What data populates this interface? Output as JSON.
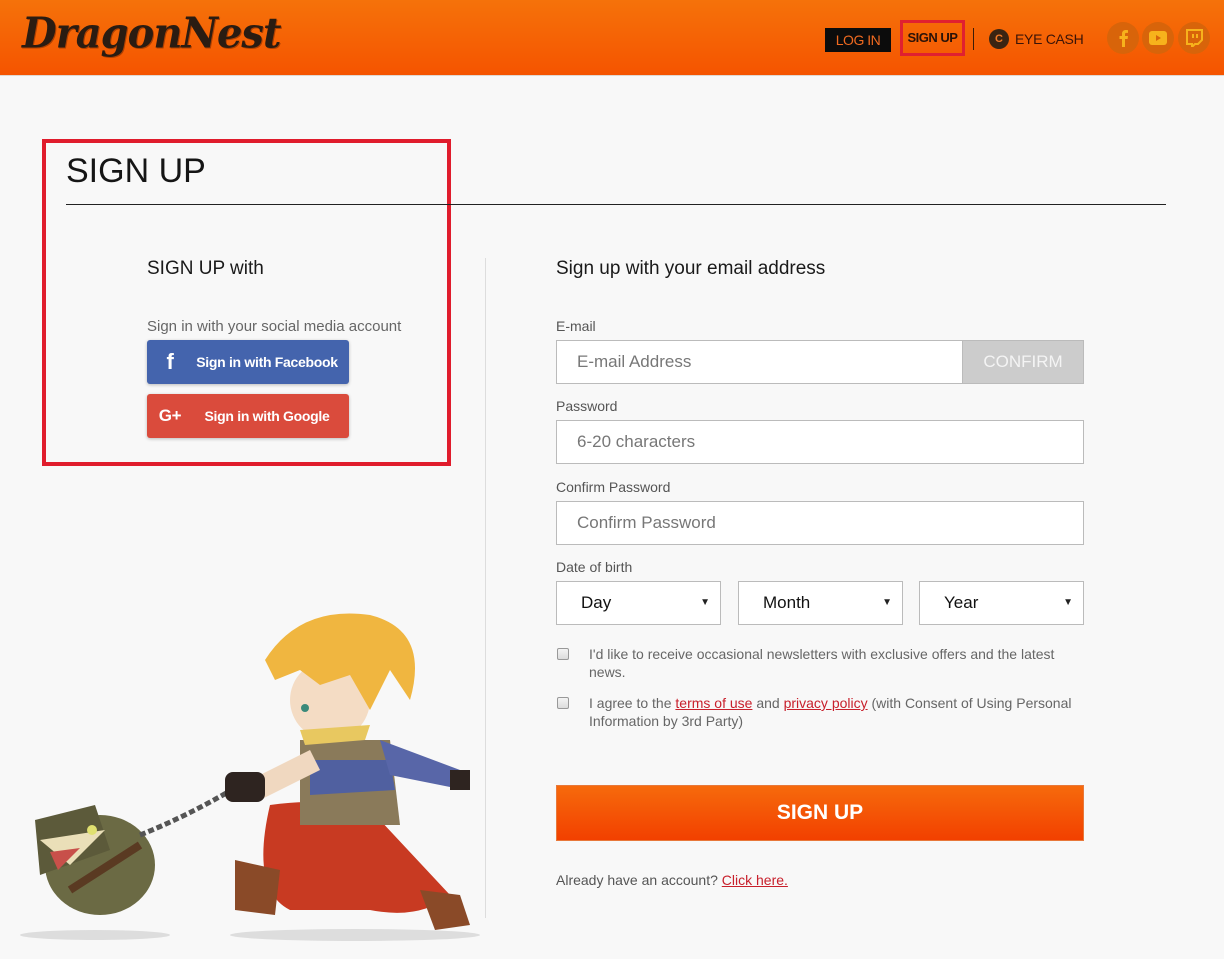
{
  "header": {
    "logo": "DragonNest",
    "login_label": "LOG IN",
    "signup_label": "SIGN UP",
    "eyecash_icon": "C",
    "eyecash_label": "EYE CASH",
    "social": [
      {
        "name": "facebook-icon"
      },
      {
        "name": "youtube-icon"
      },
      {
        "name": "twitch-icon"
      }
    ],
    "colors": {
      "bar": "#f56400",
      "highlight": "#e01c2c"
    }
  },
  "page": {
    "title": "SIGN UP"
  },
  "social_signup": {
    "heading": "SIGN UP with",
    "hint": "Sign in with your social media account",
    "facebook": {
      "icon": "f",
      "label": "Sign in with Facebook",
      "color": "#4464ad"
    },
    "google": {
      "icon": "G+",
      "label": "Sign in with Google",
      "color": "#da4b3c"
    }
  },
  "email_signup": {
    "heading": "Sign up with your email address",
    "email": {
      "label": "E-mail",
      "placeholder": "E-mail Address",
      "value": "",
      "confirm_label": "CONFIRM"
    },
    "password": {
      "label": "Password",
      "placeholder": "6-20 characters",
      "value": ""
    },
    "confirm_password": {
      "label": "Confirm Password",
      "placeholder": "Confirm Password",
      "value": ""
    },
    "dob": {
      "label": "Date of birth",
      "day": "Day",
      "month": "Month",
      "year": "Year",
      "arrow": "▼"
    },
    "newsletter": {
      "checked": false,
      "text": "I'd like to receive occasional newsletters with exclusive offers and the latest news."
    },
    "agree": {
      "checked": false,
      "prefix": "I agree to the ",
      "terms": "terms of use",
      "middle": " and ",
      "privacy": "privacy policy",
      "suffix": " (with Consent of Using Personal Information by 3rd Party)"
    },
    "submit_label": "SIGN UP",
    "already_text": "Already have an account? ",
    "click_here": "Click here."
  }
}
